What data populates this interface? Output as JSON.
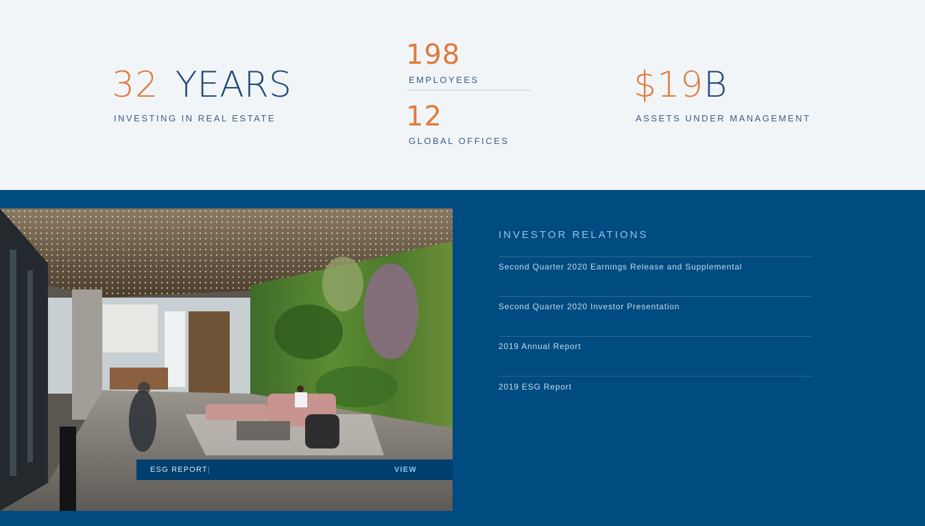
{
  "stats": {
    "years": {
      "number": "32",
      "unit": "YEARS",
      "label": "INVESTING IN REAL ESTATE"
    },
    "employees": {
      "number": "198",
      "label": "EMPLOYEES"
    },
    "offices": {
      "number": "12",
      "label": "GLOBAL OFFICES"
    },
    "assets": {
      "number": "$19",
      "unit": "B",
      "label": "ASSETS UNDER MANAGEMENT"
    }
  },
  "esg_banner": {
    "label": "ESG REPORT",
    "separator": "|",
    "cta": "VIEW"
  },
  "investor_relations": {
    "title": "INVESTOR RELATIONS",
    "links": [
      "Second Quarter 2020 Earnings Release and Supplemental",
      "Second Quarter 2020 Investor Presentation",
      "2019 Annual Report",
      "2019 ESG Report"
    ]
  },
  "colors": {
    "accent": "#e07a3a",
    "navy": "#004b7f",
    "light_bg": "#f1f5f8",
    "link_blue": "#8fc4f0"
  }
}
